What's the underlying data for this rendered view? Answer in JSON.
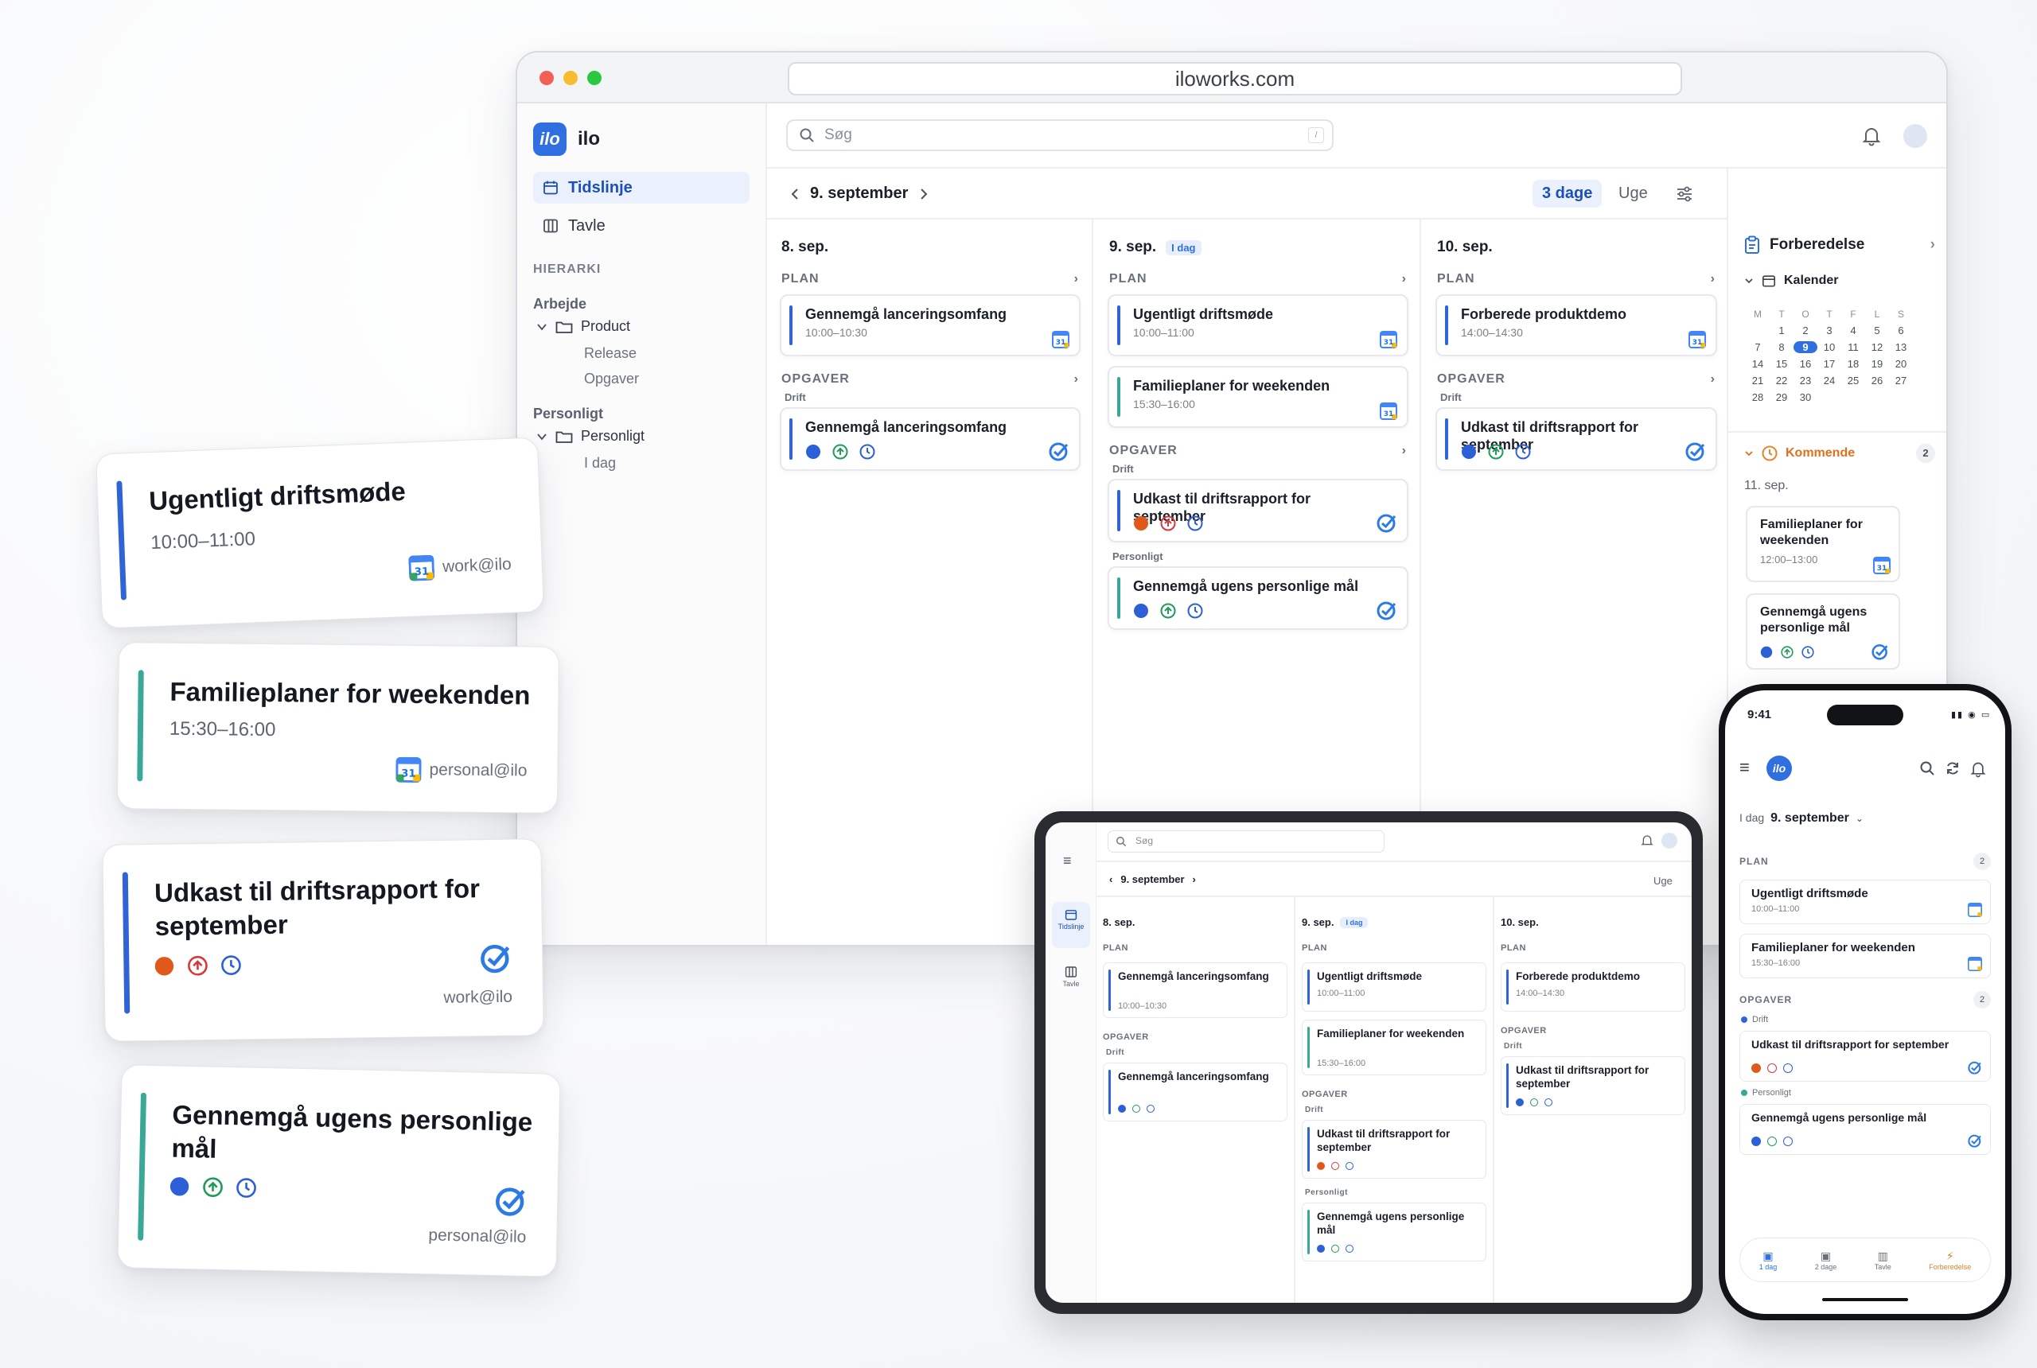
{
  "browser": {
    "url": "iloworks.com"
  },
  "app": {
    "logo_text": "ilo",
    "name": "ilo",
    "nav": [
      {
        "label": "Tidslinje",
        "icon": "calendar-icon"
      },
      {
        "label": "Tavle",
        "icon": "board-icon"
      }
    ],
    "hierarchy_heading": "HIERARKI",
    "work_group": "Arbejde",
    "work_folder": "Product",
    "work_children": [
      "Release",
      "Opgaver"
    ],
    "personal_group": "Personligt",
    "personal_folder": "Personligt",
    "personal_children": [
      "I dag"
    ],
    "search_placeholder": "Søg",
    "search_shortcut": "/",
    "current_date": "9. september",
    "view_options": [
      "3 dage",
      "Uge"
    ],
    "plan_heading": "PLAN",
    "tasks_heading": "OPGAVER",
    "today_badge": "I dag",
    "columns": [
      {
        "date": "8. sep.",
        "plan": [
          {
            "title": "Gennemgå lanceringsomfang",
            "time": "10:00–10:30"
          }
        ],
        "task_group": "Drift",
        "tasks": [
          {
            "title": "Gennemgå lanceringsomfang"
          }
        ]
      },
      {
        "date": "9. sep.",
        "plan": [
          {
            "title": "Ugentligt driftsmøde",
            "time": "10:00–11:00"
          },
          {
            "title": "Familieplaner for weekenden",
            "time": "15:30–16:00"
          }
        ],
        "task_group": "Drift",
        "tasks": [
          {
            "title": "Udkast til driftsrapport for september"
          }
        ],
        "task_group_2": "Personligt",
        "tasks_2": [
          {
            "title": "Gennemgå ugens personlige mål"
          }
        ]
      },
      {
        "date": "10. sep.",
        "plan": [
          {
            "title": "Forberede produktdemo",
            "time": "14:00–14:30"
          }
        ],
        "task_group": "Drift",
        "tasks": [
          {
            "title": "Udkast til driftsrapport for september"
          }
        ]
      }
    ],
    "right_panel": {
      "title": "Forberedelse",
      "calendar_label": "Kalender",
      "weekdays": [
        "M",
        "T",
        "O",
        "T",
        "F",
        "L",
        "S"
      ],
      "days": [
        "",
        "1",
        "2",
        "3",
        "4",
        "5",
        "6",
        "7",
        "8",
        "9",
        "10",
        "11",
        "12",
        "13",
        "14",
        "15",
        "16",
        "17",
        "18",
        "19",
        "20",
        "21",
        "22",
        "23",
        "24",
        "25",
        "26",
        "27",
        "28",
        "29",
        "30"
      ],
      "selected_day": "9",
      "upcoming_label": "Kommende",
      "upcoming_count": "2",
      "upcoming_date": "11. sep.",
      "upcoming": [
        {
          "title": "Familieplaner for weekenden",
          "time": "12:00–13:00"
        },
        {
          "title": "Gennemgå ugens personlige mål"
        }
      ]
    }
  },
  "floating_cards": [
    {
      "title": "Ugentligt driftsmøde",
      "time": "10:00–11:00",
      "account": "work@ilo"
    },
    {
      "title": "Familieplaner for weekenden",
      "time": "15:30–16:00",
      "account": "personal@ilo"
    },
    {
      "title": "Udkast til driftsrapport for september",
      "account": "work@ilo"
    },
    {
      "title": "Gennemgå ugens personlige mål",
      "account": "personal@ilo"
    }
  ],
  "tablet": {
    "nav": [
      "Tidslinje",
      "Tavle"
    ],
    "search_placeholder": "Søg",
    "current_date": "9. september",
    "view": "Uge",
    "col1": {
      "date": "8. sep.",
      "plan_title": "Gennemgå lanceringsomfang",
      "plan_time": "10:00–10:30",
      "group": "Drift",
      "task": "Gennemgå lanceringsomfang"
    },
    "col2": {
      "date": "9. sep.",
      "plan1_title": "Ugentligt driftsmøde",
      "plan1_time": "10:00–11:00",
      "plan2_title": "Familieplaner for weekenden",
      "plan2_time": "15:30–16:00",
      "group": "Drift",
      "task": "Udkast til driftsrapport for september",
      "group2": "Personligt",
      "task2": "Gennemgå ugens personlige mål"
    },
    "col3": {
      "date": "10. sep.",
      "plan_title": "Forberede produktdemo",
      "plan_time": "14:00–14:30",
      "group": "Drift",
      "task": "Udkast til driftsrapport for september"
    }
  },
  "phone": {
    "time": "9:41",
    "today_prefix": "I dag",
    "current_date": "9. september",
    "plan_heading": "PLAN",
    "plan_count": "2",
    "plan": [
      {
        "title": "Ugentligt driftsmøde",
        "time": "10:00–11:00"
      },
      {
        "title": "Familieplaner for weekenden",
        "time": "15:30–16:00"
      }
    ],
    "tasks_heading": "OPGAVER",
    "tasks_count": "2",
    "group1": "Drift",
    "task1": "Udkast til driftsrapport for september",
    "group2": "Personligt",
    "task2": "Gennemgå ugens personlige mål",
    "tabs": [
      "1 dag",
      "2 dage",
      "Tavle",
      "Forberedelse"
    ]
  },
  "colors": {
    "accent": "#2f6fe0",
    "work_bar": "#2f63d6",
    "personal_bar": "#3aa897",
    "status_orange": "#e0591a",
    "status_red": "#d8383a",
    "status_green": "#1f9a59",
    "upcoming_orange": "#e8852a"
  }
}
